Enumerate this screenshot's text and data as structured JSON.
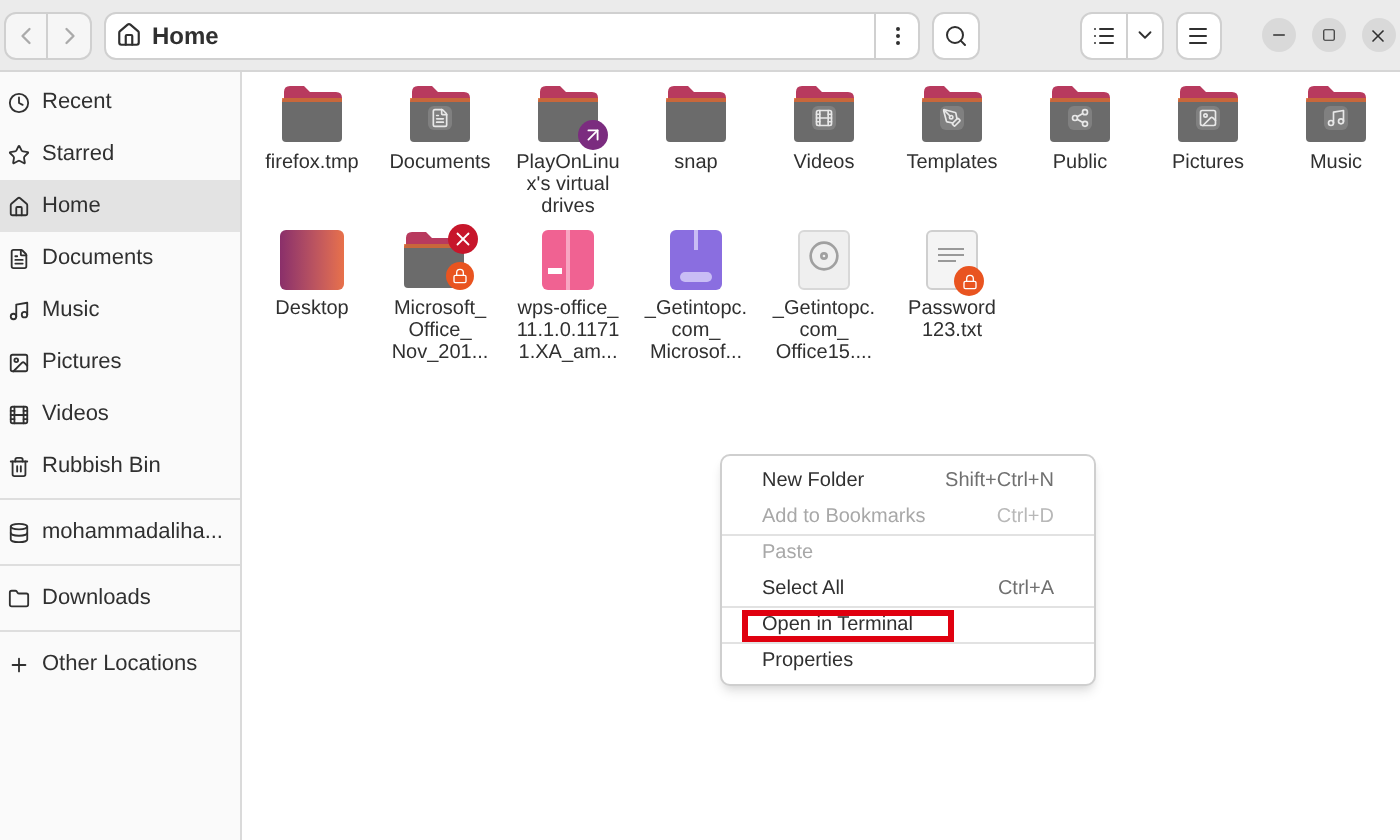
{
  "path_bar": {
    "location": "Home"
  },
  "sidebar": {
    "groups": [
      [
        {
          "label": "Recent",
          "selected": false
        },
        {
          "label": "Starred",
          "selected": false
        },
        {
          "label": "Home",
          "selected": true
        },
        {
          "label": "Documents",
          "selected": false
        },
        {
          "label": "Music",
          "selected": false
        },
        {
          "label": "Pictures",
          "selected": false
        },
        {
          "label": "Videos",
          "selected": false
        },
        {
          "label": "Rubbish Bin",
          "selected": false
        }
      ],
      [
        {
          "label": "mohammadaliha...",
          "selected": false
        }
      ],
      [
        {
          "label": "Downloads",
          "selected": false
        }
      ],
      [
        {
          "label": "Other Locations",
          "selected": false
        }
      ]
    ]
  },
  "files": [
    {
      "kind": "folder",
      "lines": [
        "firefox.tmp"
      ]
    },
    {
      "kind": "folder-documents",
      "lines": [
        "Documents"
      ]
    },
    {
      "kind": "folder-link",
      "lines": [
        "PlayOnLinu",
        "x's virtual",
        "drives"
      ]
    },
    {
      "kind": "folder",
      "lines": [
        "snap"
      ]
    },
    {
      "kind": "folder-videos",
      "lines": [
        "Videos"
      ]
    },
    {
      "kind": "folder-templates",
      "lines": [
        "Templates"
      ]
    },
    {
      "kind": "folder-public",
      "lines": [
        "Public"
      ]
    },
    {
      "kind": "folder-pictures",
      "lines": [
        "Pictures"
      ]
    },
    {
      "kind": "folder-music",
      "lines": [
        "Music"
      ]
    },
    {
      "kind": "desktop",
      "lines": [
        "Desktop"
      ]
    },
    {
      "kind": "folder-locked",
      "lines": [
        "Microsoft_",
        "Office_",
        "Nov_201..."
      ]
    },
    {
      "kind": "package",
      "lines": [
        "wps-office_",
        "11.1.0.1171",
        "1.XA_am..."
      ]
    },
    {
      "kind": "archive",
      "lines": [
        "_Getintopc.",
        "com_",
        "Microsof..."
      ]
    },
    {
      "kind": "disc-image",
      "lines": [
        "_Getintopc.",
        "com_",
        "Office15...."
      ]
    },
    {
      "kind": "text-locked",
      "lines": [
        "Password",
        "123.txt"
      ]
    }
  ],
  "context_menu": {
    "items": [
      {
        "label": "New Folder",
        "shortcut": "Shift+Ctrl+N",
        "disabled": false,
        "separator_before": false,
        "highlighted": false
      },
      {
        "label": "Add to Bookmarks",
        "shortcut": "Ctrl+D",
        "disabled": true,
        "separator_before": false,
        "highlighted": false
      },
      {
        "label": "Paste",
        "disabled": true,
        "separator_before": true,
        "highlighted": false
      },
      {
        "label": "Select All",
        "shortcut": "Ctrl+A",
        "disabled": false,
        "separator_before": false,
        "highlighted": false
      },
      {
        "label": "Open in Terminal",
        "disabled": false,
        "separator_before": true,
        "highlighted": true
      },
      {
        "label": "Properties",
        "disabled": false,
        "separator_before": true,
        "highlighted": false
      }
    ]
  }
}
